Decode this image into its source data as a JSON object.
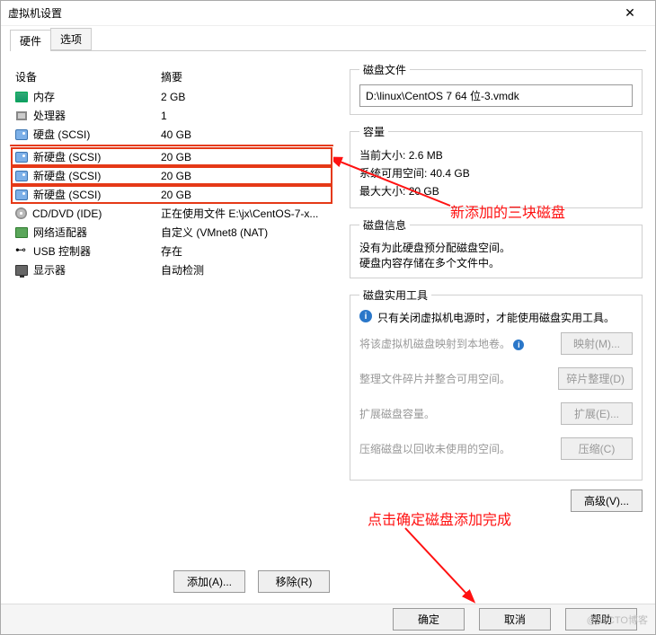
{
  "window": {
    "title": "虚拟机设置",
    "close": "✕"
  },
  "tabs": {
    "hardware": "硬件",
    "options": "选项"
  },
  "columns": {
    "device": "设备",
    "summary": "摘要"
  },
  "devices": {
    "memory": {
      "name": "内存",
      "summary": "2 GB"
    },
    "cpu": {
      "name": "处理器",
      "summary": "1"
    },
    "hdd0": {
      "name": "硬盘 (SCSI)",
      "summary": "40 GB"
    },
    "hdd1": {
      "name": "新硬盘 (SCSI)",
      "summary": "20 GB"
    },
    "hdd2": {
      "name": "新硬盘 (SCSI)",
      "summary": "20 GB"
    },
    "hdd3": {
      "name": "新硬盘 (SCSI)",
      "summary": "20 GB"
    },
    "cd": {
      "name": "CD/DVD (IDE)",
      "summary": "正在使用文件 E:\\jx\\CentOS-7-x..."
    },
    "net": {
      "name": "网络适配器",
      "summary": "自定义 (VMnet8 (NAT)"
    },
    "usb": {
      "name": "USB 控制器",
      "summary": "存在"
    },
    "mon": {
      "name": "显示器",
      "summary": "自动检测"
    }
  },
  "buttons": {
    "add": "添加(A)...",
    "remove": "移除(R)",
    "ok": "确定",
    "cancel": "取消",
    "help": "帮助",
    "map": "映射(M)...",
    "defrag": "碎片整理(D)",
    "expand": "扩展(E)...",
    "compact": "压缩(C)",
    "advanced": "高级(V)..."
  },
  "right": {
    "file_legend": "磁盘文件",
    "file_path": "D:\\linux\\CentOS 7 64 位-3.vmdk",
    "capacity_legend": "容量",
    "cur_label": "当前大小:",
    "cur_val": "2.6 MB",
    "free_label": "系统可用空间:",
    "free_val": "40.4 GB",
    "max_label": "最大大小:",
    "max_val": "20 GB",
    "info_legend": "磁盘信息",
    "info_l1": "没有为此硬盘预分配磁盘空间。",
    "info_l2": "硬盘内容存储在多个文件中。",
    "util_legend": "磁盘实用工具",
    "util_note": "只有关闭虚拟机电源时，才能使用磁盘实用工具。",
    "map_text": "将该虚拟机磁盘映射到本地卷。",
    "defrag_text": "整理文件碎片并整合可用空间。",
    "expand_text": "扩展磁盘容量。",
    "compact_text": "压缩磁盘以回收未使用的空间。"
  },
  "anno": {
    "a1": "新添加的三块磁盘",
    "a2": "点击确定磁盘添加完成"
  },
  "watermark": "@51CTO博客"
}
